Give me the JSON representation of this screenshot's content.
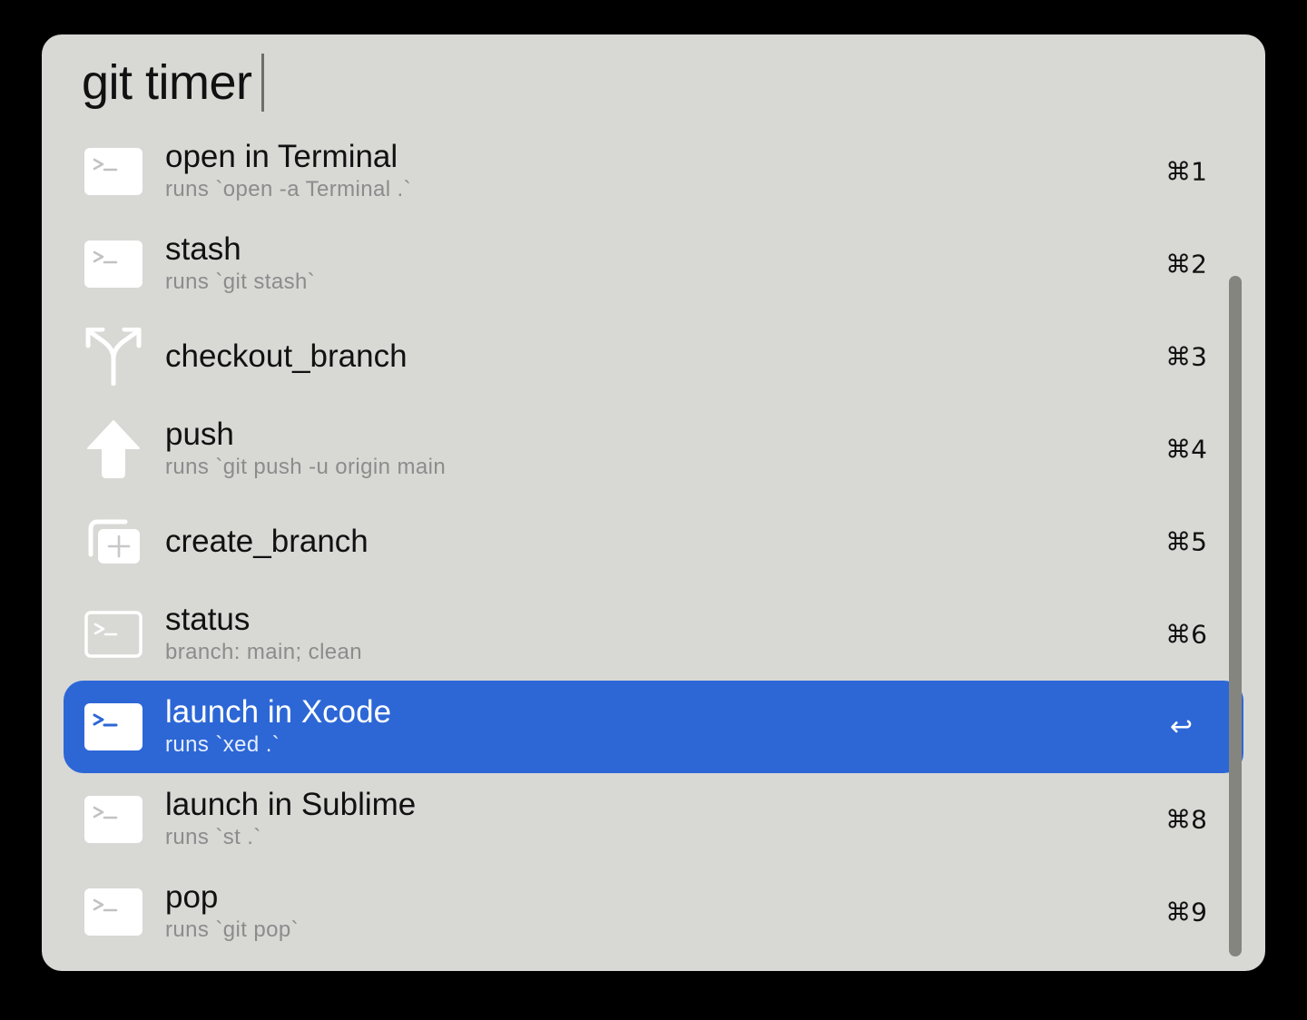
{
  "search": {
    "query": "git timer"
  },
  "results": [
    {
      "title": "open in Terminal",
      "subtitle": "runs `open -a Terminal .`",
      "shortcut": "⌘1",
      "icon": "terminal-icon"
    },
    {
      "title": "stash",
      "subtitle": "runs `git stash`",
      "shortcut": "⌘2",
      "icon": "terminal-icon"
    },
    {
      "title": "checkout_branch",
      "subtitle": "",
      "shortcut": "⌘3",
      "icon": "branch-icon"
    },
    {
      "title": "push",
      "subtitle": "runs `git push -u origin main",
      "shortcut": "⌘4",
      "icon": "arrow-up-icon"
    },
    {
      "title": "create_branch",
      "subtitle": "",
      "shortcut": "⌘5",
      "icon": "add-window-icon"
    },
    {
      "title": "status",
      "subtitle": "branch: main; clean",
      "shortcut": "⌘6",
      "icon": "terminal-outline-icon"
    },
    {
      "title": "launch in Xcode",
      "subtitle": "runs `xed .`",
      "shortcut": "↩",
      "icon": "terminal-icon",
      "selected": true
    },
    {
      "title": "launch in Sublime",
      "subtitle": "runs `st .`",
      "shortcut": "⌘8",
      "icon": "terminal-icon"
    },
    {
      "title": "pop",
      "subtitle": "runs `git pop`",
      "shortcut": "⌘9",
      "icon": "terminal-icon"
    }
  ],
  "colors": {
    "panel_background": "#d8d8d5",
    "selection": "#2d67d6",
    "scrollbar": "#858580"
  }
}
